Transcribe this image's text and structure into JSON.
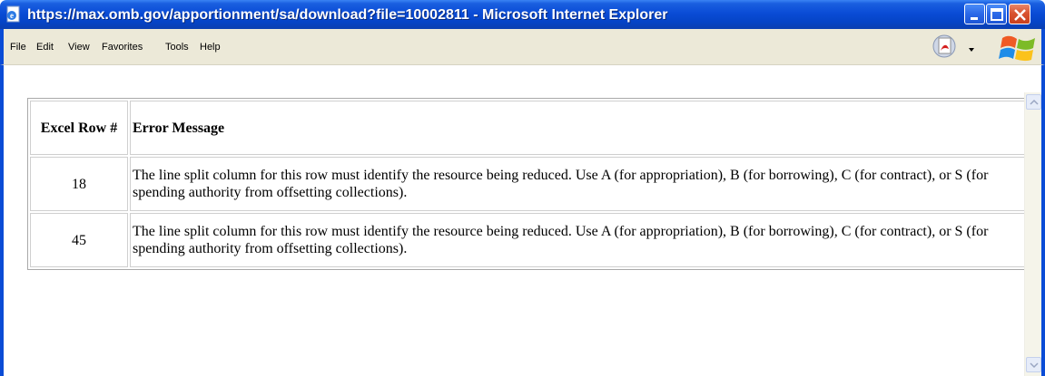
{
  "window": {
    "title": "https://max.omb.gov/apportionment/sa/download?file=10002811 - Microsoft Internet Explorer",
    "title_bar_color": "#0a4cd6",
    "icons": [
      "ie-page-icon",
      "minimize-icon",
      "maximize-icon",
      "close-icon"
    ]
  },
  "menu": {
    "items": [
      "File",
      "Edit",
      "View",
      "Favorites",
      "Tools",
      "Help"
    ],
    "toolbar_icons": [
      "pdf-icon",
      "dropdown-arrow-icon",
      "windows-logo-icon"
    ]
  },
  "table": {
    "headers": {
      "row": "Excel Row #",
      "message": "Error Message"
    },
    "rows": [
      {
        "row": "18",
        "message": "The line split column for this row must identify the resource being reduced. Use A (for appropriation), B (for borrowing), C (for contract), or S (for spending authority from offsetting collections)."
      },
      {
        "row": "45",
        "message": "The line split column for this row must identify the resource being reduced. Use A (for appropriation), B (for borrowing), C (for contract), or S (for spending authority from offsetting collections)."
      }
    ]
  }
}
